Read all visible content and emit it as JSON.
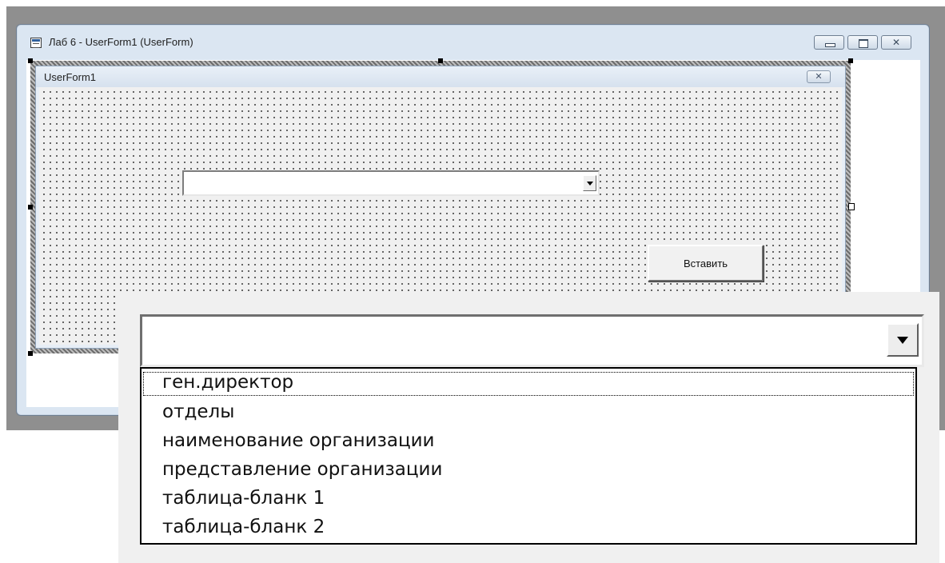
{
  "vbe_window": {
    "title": "Лаб 6 - UserForm1 (UserForm)",
    "icon": "userform-designer-icon",
    "buttons": {
      "minimize": "minimize-icon",
      "restore": "restore-icon",
      "close": "close-icon"
    }
  },
  "userform": {
    "caption": "UserForm1",
    "close_icon": "close-icon",
    "combobox": {
      "value": "",
      "dropdown_icon": "chevron-down-icon"
    },
    "insert_button_label": "Вставить"
  },
  "zoom_inset": {
    "combobox": {
      "value": "",
      "dropdown_icon": "chevron-down-icon"
    },
    "dropdown_items": [
      "ген.директор",
      "отделы",
      "наименование организации",
      "представление организации",
      "таблица-бланк 1",
      "таблица-бланк 2"
    ],
    "focused_item": "ген.директор"
  }
}
